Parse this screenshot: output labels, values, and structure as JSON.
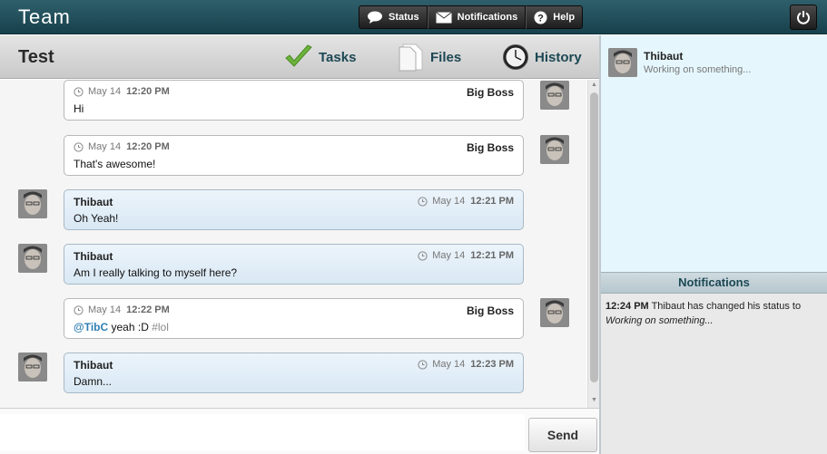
{
  "app": {
    "title": "Team"
  },
  "topnav": {
    "status_label": "Status",
    "notifications_label": "Notifications",
    "help_label": "Help"
  },
  "room": {
    "title": "Test"
  },
  "tabs": {
    "tasks": "Tasks",
    "files": "Files",
    "history": "History"
  },
  "messages": [
    {
      "author": "Big Boss",
      "date": "May 14",
      "time": "12:20 PM",
      "text": "Hi",
      "own": true
    },
    {
      "author": "Big Boss",
      "date": "May 14",
      "time": "12:20 PM",
      "text": "That's awesome!",
      "own": true
    },
    {
      "author": "Thibaut",
      "date": "May 14",
      "time": "12:21 PM",
      "text": "Oh Yeah!",
      "own": false
    },
    {
      "author": "Thibaut",
      "date": "May 14",
      "time": "12:21 PM",
      "text": "Am I really talking to myself here?",
      "own": false
    },
    {
      "author": "Big Boss",
      "date": "May 14",
      "time": "12:22 PM",
      "mention": "@TibC",
      "text": "yeah :D",
      "hashtag": "#lol",
      "own": true
    },
    {
      "author": "Thibaut",
      "date": "May 14",
      "time": "12:23 PM",
      "text": "Damn...",
      "own": false
    }
  ],
  "composer": {
    "placeholder": "",
    "value": "",
    "send_label": "Send"
  },
  "users": [
    {
      "name": "Thibaut",
      "status": "Working on something..."
    }
  ],
  "notifications": {
    "title": "Notifications",
    "items": [
      {
        "time": "12:24 PM",
        "text": "Thibaut has changed his status to",
        "status": "Working on something..."
      }
    ]
  },
  "colors": {
    "topbar": "#17414c",
    "accent": "#1c4854",
    "users_bg": "#e5f7fd",
    "other_bubble": "#d9e8f4",
    "mention": "#2f7fb3"
  }
}
